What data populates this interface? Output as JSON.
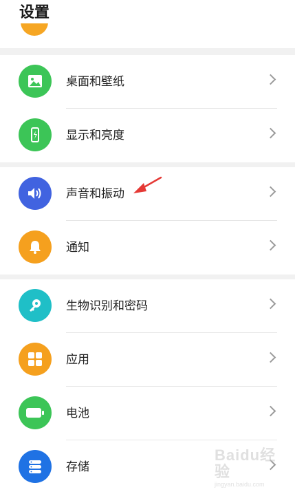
{
  "header": {
    "title": "设置"
  },
  "groups": [
    {
      "items": [
        {
          "label": "桌面和壁纸",
          "icon": "wallpaper-icon",
          "color": "#3cc557"
        },
        {
          "label": "显示和亮度",
          "icon": "display-brightness-icon",
          "color": "#3cc557"
        }
      ]
    },
    {
      "items": [
        {
          "label": "声音和振动",
          "icon": "sound-icon",
          "color": "#4163e0"
        },
        {
          "label": "通知",
          "icon": "bell-icon",
          "color": "#f5a01e"
        }
      ]
    },
    {
      "items": [
        {
          "label": "生物识别和密码",
          "icon": "key-icon",
          "color": "#1fbfc7"
        },
        {
          "label": "应用",
          "icon": "apps-grid-icon",
          "color": "#f5a01e"
        },
        {
          "label": "电池",
          "icon": "battery-icon",
          "color": "#3cc557"
        },
        {
          "label": "存储",
          "icon": "storage-icon",
          "color": "#1f72e4"
        }
      ]
    }
  ],
  "annotation": {
    "color": "#e53935"
  },
  "watermark": {
    "logo": "Baidu经验",
    "url": "jingyan.baidu.com"
  }
}
